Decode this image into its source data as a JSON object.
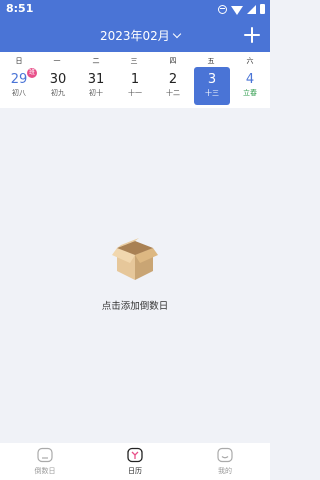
{
  "status_bar": {
    "time": "8:51"
  },
  "header": {
    "month_title": "2023年02月"
  },
  "weekdays": [
    "日",
    "一",
    "二",
    "三",
    "四",
    "五",
    "六"
  ],
  "days": [
    {
      "num": "29",
      "lunar": "初八",
      "badge": "班"
    },
    {
      "num": "30",
      "lunar": "初九"
    },
    {
      "num": "31",
      "lunar": "初十"
    },
    {
      "num": "1",
      "lunar": "十一"
    },
    {
      "num": "2",
      "lunar": "十二"
    },
    {
      "num": "3",
      "lunar": "十三",
      "selected": true
    },
    {
      "num": "4",
      "lunar": "立春"
    }
  ],
  "empty_state": {
    "text": "点击添加倒数日"
  },
  "bottom_nav": [
    {
      "label": "倒数日",
      "icon": "countdown-icon"
    },
    {
      "label": "日历",
      "icon": "calendar-icon",
      "active": true
    },
    {
      "label": "我的",
      "icon": "profile-icon"
    }
  ],
  "colors": {
    "accent": "#4a74d6",
    "badge": "#e8508a",
    "solar_term": "#2e9b4b",
    "background": "#f0f2f7"
  }
}
